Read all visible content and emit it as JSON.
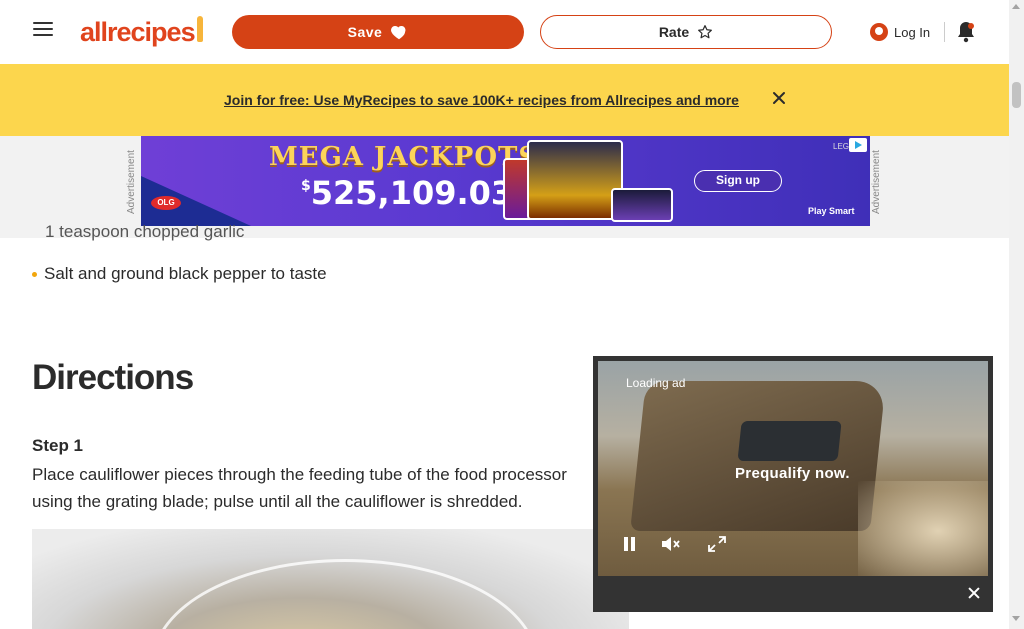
{
  "header": {
    "logo_text": "allrecipes",
    "save_label": "Save",
    "rate_label": "Rate",
    "login_label": "Log In"
  },
  "promo": {
    "link_text": "Join for free: Use MyRecipes to save 100K+ recipes from Allrecipes and more"
  },
  "ad": {
    "side_label": "Advertisement",
    "title": "MEGA JACKPOTS",
    "prize_currency": "$",
    "prize_amount": "525,109.03",
    "signup_label": "Sign up",
    "footer": "Play Smart",
    "tag": "LEG",
    "icons": [
      "olg-logo-icon",
      "adchoices-icon"
    ]
  },
  "article": {
    "partial_ingredient": "1 teaspoon chopped garlic",
    "ingredient": "Salt and ground black pepper to taste",
    "directions_heading": "Directions",
    "step_title": "Step 1",
    "step_text": "Place cauliflower pieces through the feeding tube of the food processor using the grating blade; pulse until all the cauliflower is shredded."
  },
  "video": {
    "loading_text": "Loading ad",
    "overlay_text": "Prequalify now.",
    "icons": [
      "pause-icon",
      "mute-icon",
      "fullscreen-icon",
      "close-icon"
    ]
  },
  "colors": {
    "brand": "#d54215",
    "promo_bg": "#fcd64d",
    "bullet": "#f2a60c"
  }
}
